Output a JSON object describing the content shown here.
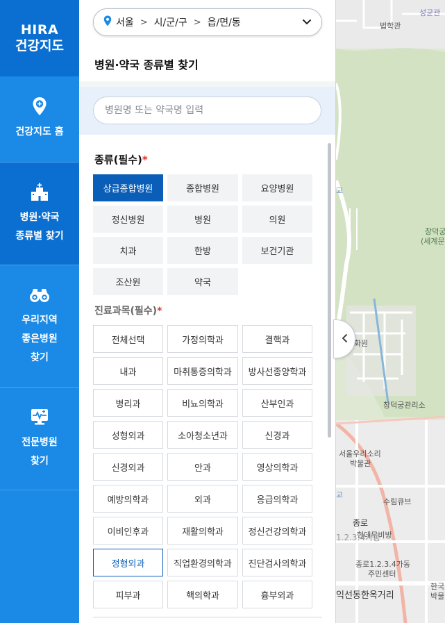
{
  "rail": {
    "logo_line1": "HIRA",
    "logo_line2": "건강지도",
    "items": [
      {
        "label_lines": [
          "건강지도 홈"
        ],
        "icon": "map-pin-plus-icon"
      },
      {
        "label_lines": [
          "병원·약국",
          "종류별 찾기"
        ],
        "icon": "hospital-building-icon",
        "active": true
      },
      {
        "label_lines": [
          "우리지역",
          "좋은병원",
          "찾기"
        ],
        "icon": "binoculars-icon"
      },
      {
        "label_lines": [
          "전문병원",
          "찾기"
        ],
        "icon": "ecg-monitor-icon"
      }
    ]
  },
  "region": {
    "sido": "서울",
    "sigungu": "시/군/구",
    "eupmyeondong": "읍/면/동"
  },
  "panel_title": "병원·약국 종류별 찾기",
  "search": {
    "placeholder": "병원명 또는 약국명 입력"
  },
  "types": {
    "heading": "종류(필수)",
    "required_mark": "*",
    "items": [
      "상급종합병원",
      "종합병원",
      "요양병원",
      "정신병원",
      "병원",
      "의원",
      "치과",
      "한방",
      "보건기관",
      "조산원",
      "약국"
    ],
    "selected": "상급종합병원"
  },
  "subjects": {
    "heading": "진료과목(필수)",
    "required_mark": "*",
    "items": [
      "전체선택",
      "가정의학과",
      "결핵과",
      "내과",
      "마취통증의학과",
      "방사선종양학과",
      "병리과",
      "비뇨의학과",
      "산부인과",
      "성형외과",
      "소아청소년과",
      "신경과",
      "신경외과",
      "안과",
      "영상의학과",
      "예방의학과",
      "외과",
      "응급의학과",
      "이비인후과",
      "재활의학과",
      "정신건강의학과",
      "정형외과",
      "직업환경의학과",
      "진단검사의학과",
      "피부과",
      "핵의학과",
      "흉부외과"
    ],
    "selected": "정형외과"
  },
  "map": {
    "labels": {
      "seonggyungwan": "성균관",
      "beophakgwan": "법학관",
      "changdeokgung": "창덕궁",
      "world_heritage": "(세계문화",
      "changdeokgung_office": "창덕궁관리소",
      "folk_museum_1": "서울우리소리",
      "folk_museum_2": "박물관",
      "surim_cube": "수림큐브",
      "jongno_line1": "종로",
      "jongno_line2": "1.2.3.4가동",
      "modern_hanok": "현대무비방",
      "community_1": "종로1.2.3.4가동",
      "community_2": "주민센터",
      "iksun": "익선동한옥거리",
      "hanguk_1": "한국",
      "hanguk_2": "박물",
      "hwa": "화원",
      "gyo1": "교",
      "gyo2": "교"
    }
  }
}
